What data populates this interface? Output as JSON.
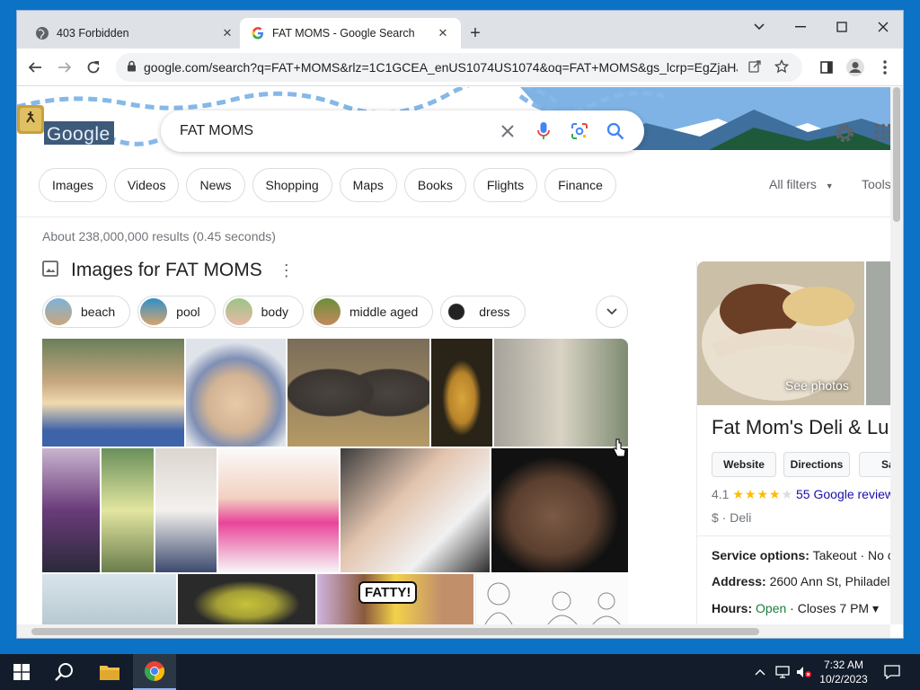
{
  "browser": {
    "tabs": [
      {
        "title": "403 Forbidden",
        "active": false
      },
      {
        "title": "FAT MOMS - Google Search",
        "active": true
      }
    ],
    "url": "google.com/search?q=FAT+MOMS&rlz=1C1GCEA_enUS1074US1074&oq=FAT+MOMS&gs_lcrp=EgZjaHJv..."
  },
  "search": {
    "query": "FAT MOMS",
    "logo_text": "Google"
  },
  "filters": [
    "Images",
    "Videos",
    "News",
    "Shopping",
    "Maps",
    "Books",
    "Flights",
    "Finance"
  ],
  "all_filters": "All filters",
  "tools": "Tools",
  "result_stats": "About 238,000,000 results (0.45 seconds)",
  "images_section": {
    "title": "Images for FAT MOMS",
    "refinements": [
      "beach",
      "pool",
      "body",
      "middle aged",
      "dress"
    ]
  },
  "knowledge_panel": {
    "see_photos": "See photos",
    "title": "Fat Mom's Deli & Lu",
    "buttons": [
      "Website",
      "Directions",
      "Sa"
    ],
    "rating": "4.1",
    "stars": "★★★★",
    "half_star": "★",
    "reviews": "55 Google review",
    "price": "$",
    "category": "Deli",
    "service_label": "Service options:",
    "service_value": "Takeout · No c",
    "address_label": "Address:",
    "address_value": "2600 Ann St, Philadel",
    "hours_label": "Hours:",
    "hours_open": "Open",
    "hours_value": "· Closes 7 PM ▾"
  },
  "taskbar": {
    "time": "7:32 AM",
    "date": "10/2/2023"
  },
  "colors": {
    "desktop": "#0c72c6",
    "link": "#1a0dab",
    "open": "#188038",
    "star": "#fbbc04"
  }
}
